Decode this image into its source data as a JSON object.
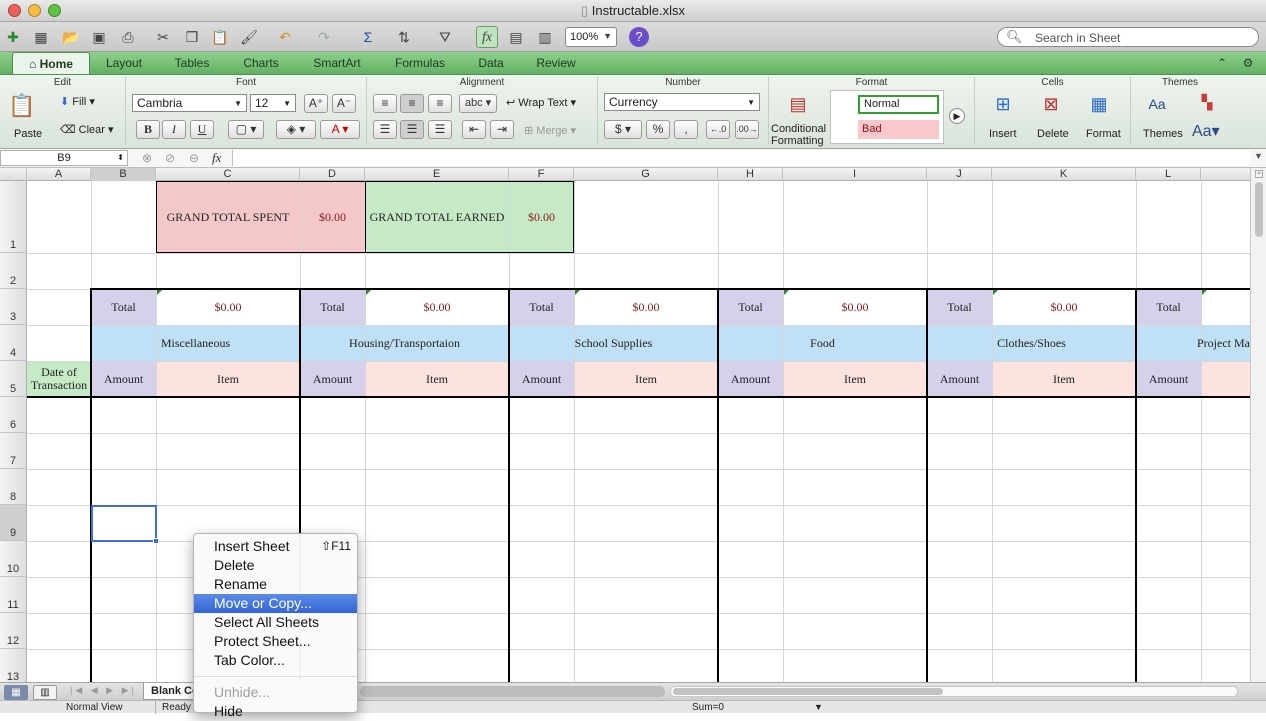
{
  "window": {
    "title": "Instructable.xlsx"
  },
  "toolbar": {
    "zoom": "100%",
    "search_placeholder": "Search in Sheet"
  },
  "ribbon_tabs": [
    "Home",
    "Layout",
    "Tables",
    "Charts",
    "SmartArt",
    "Formulas",
    "Data",
    "Review"
  ],
  "ribbon": {
    "groups": {
      "edit": "Edit",
      "font": "Font",
      "alignment": "Alignment",
      "number": "Number",
      "format": "Format",
      "cells": "Cells",
      "themes": "Themes"
    },
    "paste": "Paste",
    "fill": "Fill",
    "clear": "Clear",
    "font_name": "Cambria",
    "font_size": "12",
    "bold": "B",
    "italic": "I",
    "underline": "U",
    "wrap_text": "Wrap Text",
    "merge": "Merge",
    "abc": "abc",
    "number_format": "Currency",
    "percent": "%",
    "comma": ",",
    "conditional_1": "Conditional",
    "conditional_2": "Formatting",
    "style_normal": "Normal",
    "style_bad": "Bad",
    "insert": "Insert",
    "delete": "Delete",
    "format": "Format",
    "themes": "Themes",
    "aa": "Aa"
  },
  "formula_bar": {
    "name_box": "B9",
    "fx": "fx",
    "value": ""
  },
  "columns": [
    "A",
    "B",
    "C",
    "D",
    "E",
    "F",
    "G",
    "H",
    "I",
    "J",
    "K",
    "L"
  ],
  "rows": [
    "1",
    "2",
    "3",
    "4",
    "5",
    "6",
    "7",
    "8",
    "9",
    "10",
    "11",
    "12",
    "13"
  ],
  "sheet": {
    "grand_total_spent_label": "GRAND TOTAL SPENT",
    "grand_total_spent_value": "$0.00",
    "grand_total_earned_label": "GRAND TOTAL EARNED",
    "grand_total_earned_value": "$0.00",
    "date_header_1": "Date of",
    "date_header_2": "Transaction",
    "categories": [
      {
        "total_label": "Total",
        "total_value": "$0.00",
        "name": "Miscellaneous",
        "amount": "Amount",
        "item": "Item"
      },
      {
        "total_label": "Total",
        "total_value": "$0.00",
        "name": "Housing/Transportaion",
        "amount": "Amount",
        "item": "Item"
      },
      {
        "total_label": "Total",
        "total_value": "$0.00",
        "name": "School Supplies",
        "amount": "Amount",
        "item": "Item"
      },
      {
        "total_label": "Total",
        "total_value": "$0.00",
        "name": "Food",
        "amount": "Amount",
        "item": "Item"
      },
      {
        "total_label": "Total",
        "total_value": "$0.00",
        "name": "Clothes/Shoes",
        "amount": "Amount",
        "item": "Item"
      },
      {
        "total_label": "Total",
        "name": "Project Ma",
        "amount": "Amount"
      }
    ]
  },
  "sheet_tabs": [
    "Blank Co"
  ],
  "context_menu": {
    "items": [
      {
        "label": "Insert Sheet",
        "shortcut": "⇧F11"
      },
      {
        "label": "Delete"
      },
      {
        "label": "Rename"
      },
      {
        "label": "Move or Copy..."
      },
      {
        "label": "Select All Sheets"
      },
      {
        "label": "Protect Sheet..."
      },
      {
        "label": "Tab Color..."
      }
    ],
    "disabled": "Unhide...",
    "hide": "Hide"
  },
  "status": {
    "view": "Normal View",
    "state": "Ready",
    "sum": "Sum=0"
  },
  "colors": {
    "ribbon_green": "#6db96d",
    "pink": "#f4c7c9",
    "green": "#c6e9c6",
    "purple": "#d7d0ea",
    "blue": "#bfe0f6",
    "light_pink": "#fde3e0",
    "menu_highlight": "#3b6fd8"
  }
}
